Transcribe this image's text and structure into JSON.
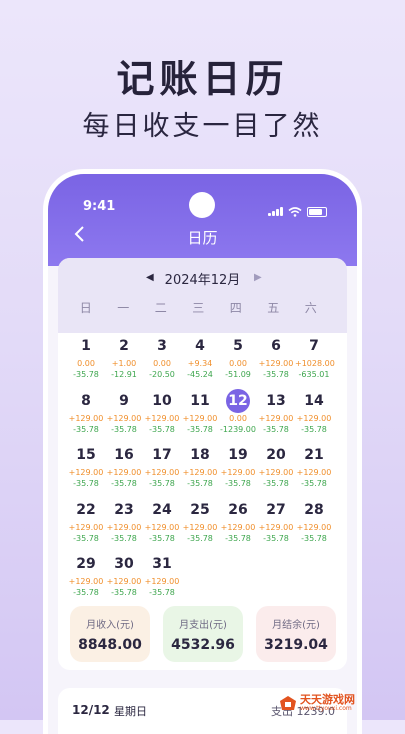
{
  "promo": {
    "headline": "记账日历",
    "subline": "每日收支一目了然"
  },
  "status": {
    "time": "9:41"
  },
  "header": {
    "title": "日历",
    "back_icon": "chevron-left-icon"
  },
  "calendar": {
    "month_label": "2024年12月",
    "weekdays": [
      "日",
      "一",
      "二",
      "三",
      "四",
      "五",
      "六"
    ],
    "selected_day": "12",
    "days": [
      {
        "day": "1",
        "income": "0.00",
        "expense": "-35.78"
      },
      {
        "day": "2",
        "income": "+1.00",
        "expense": "-12.91"
      },
      {
        "day": "3",
        "income": "0.00",
        "expense": "-20.50"
      },
      {
        "day": "4",
        "income": "+9.34",
        "expense": "-45.24"
      },
      {
        "day": "5",
        "income": "0.00",
        "expense": "-51.09"
      },
      {
        "day": "6",
        "income": "+129.00",
        "expense": "-35.78"
      },
      {
        "day": "7",
        "income": "+1028.00",
        "expense": "-635.01"
      },
      {
        "day": "8",
        "income": "+129.00",
        "expense": "-35.78"
      },
      {
        "day": "9",
        "income": "+129.00",
        "expense": "-35.78"
      },
      {
        "day": "10",
        "income": "+129.00",
        "expense": "-35.78"
      },
      {
        "day": "11",
        "income": "+129.00",
        "expense": "-35.78"
      },
      {
        "day": "12",
        "income": "0.00",
        "expense": "-1239.00"
      },
      {
        "day": "13",
        "income": "+129.00",
        "expense": "-35.78"
      },
      {
        "day": "14",
        "income": "+129.00",
        "expense": "-35.78"
      },
      {
        "day": "15",
        "income": "+129.00",
        "expense": "-35.78"
      },
      {
        "day": "16",
        "income": "+129.00",
        "expense": "-35.78"
      },
      {
        "day": "17",
        "income": "+129.00",
        "expense": "-35.78"
      },
      {
        "day": "18",
        "income": "+129.00",
        "expense": "-35.78"
      },
      {
        "day": "19",
        "income": "+129.00",
        "expense": "-35.78"
      },
      {
        "day": "20",
        "income": "+129.00",
        "expense": "-35.78"
      },
      {
        "day": "21",
        "income": "+129.00",
        "expense": "-35.78"
      },
      {
        "day": "22",
        "income": "+129.00",
        "expense": "-35.78"
      },
      {
        "day": "23",
        "income": "+129.00",
        "expense": "-35.78"
      },
      {
        "day": "24",
        "income": "+129.00",
        "expense": "-35.78"
      },
      {
        "day": "25",
        "income": "+129.00",
        "expense": "-35.78"
      },
      {
        "day": "26",
        "income": "+129.00",
        "expense": "-35.78"
      },
      {
        "day": "27",
        "income": "+129.00",
        "expense": "-35.78"
      },
      {
        "day": "28",
        "income": "+129.00",
        "expense": "-35.78"
      },
      {
        "day": "29",
        "income": "+129.00",
        "expense": "-35.78"
      },
      {
        "day": "30",
        "income": "+129.00",
        "expense": "-35.78"
      },
      {
        "day": "31",
        "income": "+129.00",
        "expense": "-35.78"
      }
    ]
  },
  "summary": {
    "income_label": "月收入(元)",
    "income_value": "8848.00",
    "expense_label": "月支出(元)",
    "expense_value": "4532.96",
    "balance_label": "月结余(元)",
    "balance_value": "3219.04"
  },
  "detail": {
    "date": "12/12",
    "weekday": "星期日",
    "expense": "支出 1239.0"
  },
  "watermark": {
    "text": "天天游戏网",
    "url": "www.ttyouxi.com"
  },
  "colors": {
    "accent": "#7a64e4",
    "income": "#f08f2c",
    "expense": "#3ea64e"
  }
}
